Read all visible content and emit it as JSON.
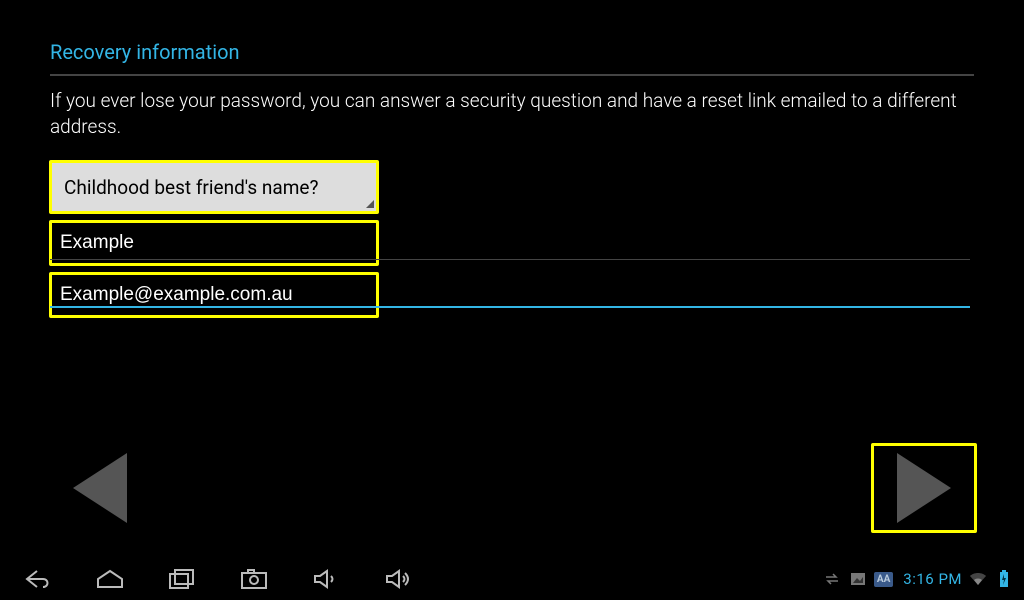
{
  "header": {
    "title": "Recovery information"
  },
  "body": {
    "description": "If you ever lose your password, you can answer a security question and have a reset link emailed to a different address."
  },
  "fields": {
    "security_question": "Childhood best friend's name?",
    "answer": "Example",
    "recovery_email": "Example@example.com.au"
  },
  "statusbar": {
    "time": "3:16 PM",
    "aa_label": "AA"
  },
  "icons": {
    "back": "back-triangle",
    "next": "next-triangle",
    "nav_back": "nav-back-icon",
    "nav_home": "nav-home-icon",
    "nav_recent": "nav-recent-icon",
    "screenshot": "camera-icon",
    "vol_down": "volume-down-icon",
    "vol_up": "volume-up-icon",
    "sync": "sync-icon",
    "gallery": "gallery-icon",
    "wifi": "wifi-icon",
    "battery": "battery-charging-icon"
  }
}
